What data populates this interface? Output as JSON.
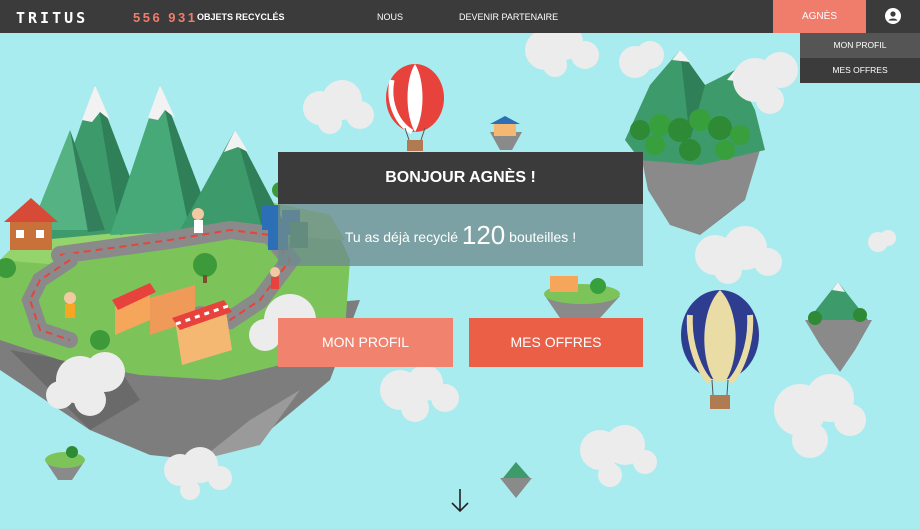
{
  "header": {
    "logo": "TRITUS",
    "counter_value": "556 931",
    "counter_label": "OBJETS RECYCLÉS",
    "nav": [
      {
        "label": "NOUS"
      },
      {
        "label": "DEVENIR PARTENAIRE"
      }
    ],
    "user_label": "AGNÈS",
    "account_icon": "user-icon"
  },
  "user_menu": {
    "items": [
      {
        "label": "MON PROFIL"
      },
      {
        "label": "MES OFFRES"
      }
    ]
  },
  "hero": {
    "greeting": "BONJOUR AGNÈS !",
    "stat_prefix": "Tu as déjà recyclé",
    "stat_value": "120",
    "stat_suffix": "bouteilles !",
    "profile_button": "MON PROFIL",
    "offers_button": "MES OFFRES",
    "scroll_icon": "arrow-down-icon"
  },
  "colors": {
    "sky": "#a9ecef",
    "bar": "#3b3b3b",
    "accent": "#f07c6b",
    "offers": "#eb5f46"
  }
}
